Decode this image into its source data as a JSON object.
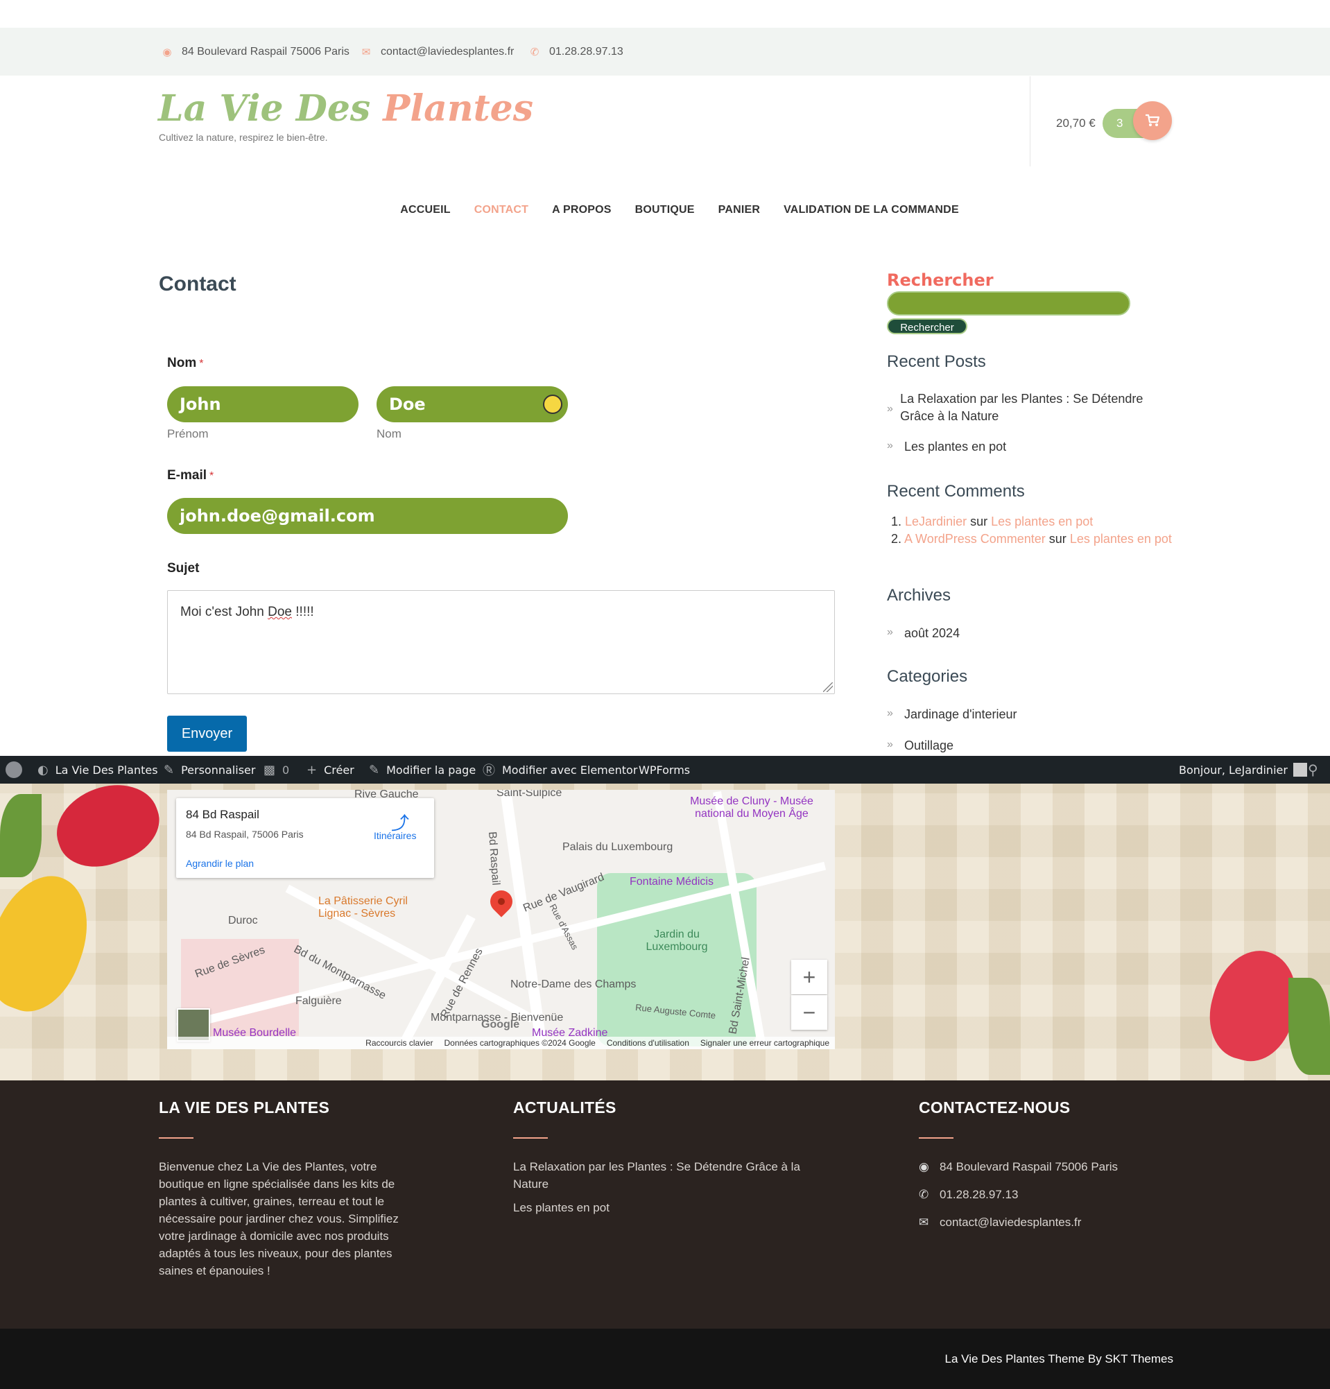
{
  "topbar": {
    "address": "84 Boulevard Raspail 75006 Paris",
    "email": "contact@laviedesplantes.fr",
    "phone": "01.28.28.97.13"
  },
  "header": {
    "logo_word1": "La Vie Des",
    "logo_word2": "Plantes",
    "tagline": "Cultivez la nature, respirez le bien-être.",
    "cart_total": "20,70 €",
    "cart_count": "3"
  },
  "nav": {
    "items": [
      "ACCUEIL",
      "CONTACT",
      "A PROPOS",
      "BOUTIQUE",
      "PANIER",
      "VALIDATION DE LA COMMANDE"
    ],
    "active": "CONTACT"
  },
  "main": {
    "title": "Contact",
    "form": {
      "name_label": "Nom",
      "required_mark": "*",
      "first_value": "John",
      "first_sublabel": "Prénom",
      "last_value": "Doe",
      "last_sublabel": "Nom",
      "email_label": "E-mail",
      "email_value": "john.doe@gmail.com",
      "subject_label": "Sujet",
      "message_prefix": "Moi c'est John ",
      "message_misspelled": "Doe",
      "message_suffix": " !!!!!",
      "submit_label": "Envoyer"
    }
  },
  "sidebar": {
    "search_title": "Rechercher",
    "search_button": "Rechercher",
    "recent_posts_title": "Recent Posts",
    "recent_posts": [
      "La Relaxation par les Plantes : Se Détendre Grâce à la Nature",
      "Les plantes en pot"
    ],
    "recent_comments_title": "Recent Comments",
    "comments": [
      {
        "num": "1.",
        "author": "LeJardinier",
        "sur": "sur",
        "post": "Les plantes en pot"
      },
      {
        "num": "2.",
        "author": "A WordPress Commenter",
        "sur": "sur",
        "post": "Les plantes en pot"
      }
    ],
    "archives_title": "Archives",
    "archives": [
      "août 2024"
    ],
    "categories_title": "Categories",
    "categories": [
      "Jardinage d'interieur",
      "Outillage"
    ]
  },
  "adminbar": {
    "site": "La Vie Des Plantes",
    "customize": "Personnaliser",
    "comments_count": "0",
    "new": "Créer",
    "edit_page": "Modifier la page",
    "elementor": "Modifier avec Elementor",
    "wpforms": "WPForms",
    "greeting": "Bonjour, LeJardinier"
  },
  "map": {
    "card_title": "84 Bd Raspail",
    "card_address": "84 Bd Raspail, 75006 Paris",
    "card_directions": "Itinéraires",
    "card_enlarge": "Agrandir le plan",
    "labels": {
      "rive_gauche": "Rive Gauche",
      "saint_sulpice": "Saint-Sulpice",
      "cluny": "Musée de Cluny - Musée national du Moyen Âge",
      "palais": "Palais du Luxembourg",
      "medicis": "Fontaine Médicis",
      "jardin": "Jardin du Luxembourg",
      "patisserie": "La Pâtisserie Cyril Lignac - Sèvres",
      "duroc": "Duroc",
      "sevres": "Rue de Sèvres",
      "vaugirard": "Rue de Vaugirard",
      "raspail": "Bd Raspail",
      "montparnasse_bd": "Bd du Montparnasse",
      "rennes": "Rue de Rennes",
      "falguiere": "Falguière",
      "nd_champs": "Notre-Dame des Champs",
      "montparnasse": "Montparnasse - Bienvenüe",
      "bourdelle": "Musée Bourdelle",
      "zadkine": "Musée Zadkine",
      "auguste_comte": "Rue Auguste Comte",
      "saint_michel": "Bd Saint-Michel",
      "assas": "Rue d'Assas",
      "google": "Google"
    },
    "zoom_in": "+",
    "zoom_out": "−",
    "footer": [
      "Raccourcis clavier",
      "Données cartographiques ©2024 Google",
      "Conditions d'utilisation",
      "Signaler une erreur cartographique"
    ]
  },
  "footer": {
    "col1_title": "LA VIE DES PLANTES",
    "col1_text": "Bienvenue chez La Vie des Plantes, votre boutique en ligne spécialisée dans les kits de plantes à cultiver, graines, terreau et tout le nécessaire pour jardiner chez vous. Simplifiez votre jardinage à domicile avec nos produits adaptés à tous les niveaux, pour des plantes saines et épanouies !",
    "col2_title": "ACTUALITÉS",
    "col2_links": [
      "La Relaxation par les Plantes : Se Détendre Grâce à la Nature",
      "Les plantes en pot"
    ],
    "col3_title": "CONTACTEZ-NOUS",
    "address": "84 Boulevard Raspail 75006 Paris",
    "phone": "01.28.28.97.13",
    "email": "contact@laviedesplantes.fr",
    "credit": "La Vie Des Plantes Theme By SKT Themes"
  },
  "colors": {
    "accent_pink": "#f3a38b",
    "accent_green": "#7ea232",
    "light_green": "#a9cc86",
    "submit_blue": "#066aab"
  }
}
